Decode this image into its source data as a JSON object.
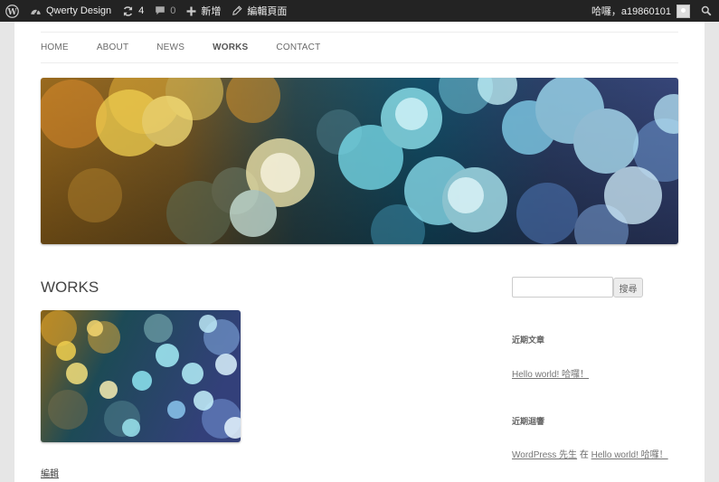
{
  "adminbar": {
    "site_name": "Qwerty Design",
    "updates_count": "4",
    "comments_count": "0",
    "new_label": "新增",
    "edit_page_label": "編輯頁面",
    "greeting": "哈囉，a19860101"
  },
  "nav": {
    "items": [
      {
        "label": "HOME"
      },
      {
        "label": "ABOUT"
      },
      {
        "label": "NEWS"
      },
      {
        "label": "WORKS"
      },
      {
        "label": "CONTACT"
      }
    ],
    "current_index": 3
  },
  "content": {
    "title": "WORKS",
    "edit_link": "編輯"
  },
  "sidebar": {
    "search": {
      "value": "",
      "placeholder": "",
      "button": "搜尋"
    },
    "recent_posts": {
      "title": "近期文章",
      "items": [
        {
          "label": "Hello world! 哈囉！"
        }
      ]
    },
    "recent_comments": {
      "title": "近期迴響",
      "author": "WordPress 先生",
      "connector": "在",
      "post": "Hello world! 哈囉！"
    }
  },
  "colors": {
    "adminbar_bg": "#232323",
    "page_bg": "#e6e6e6",
    "content_bg": "#ffffff",
    "link": "#757575"
  }
}
